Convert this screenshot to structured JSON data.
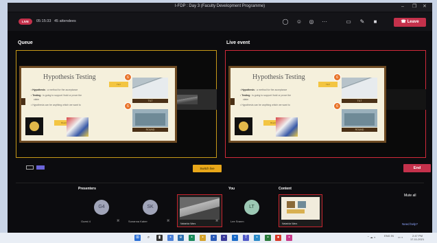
{
  "window": {
    "title": "I-FDP : Day 3 (Faculty Development Programme)"
  },
  "toolbar": {
    "live_badge": "LIVE",
    "timer": "05:15:33",
    "attendees": "45 attendees",
    "leave_label": "Leave"
  },
  "stage": {
    "queue_label": "Queue",
    "live_label": "Live event",
    "switch_label": "Switch live",
    "end_label": "End"
  },
  "slide": {
    "title": "Hypothesis Testing",
    "bullets": [
      {
        "term": "Hypothesis",
        "rest": " : a method for the acceptance"
      },
      {
        "term": "Testing",
        "rest": " : is going to support /hold or prove the"
      },
      {
        "term": "",
        "rest": "claim"
      },
      {
        "term": "",
        "rest": "Hypothesis can be anything which we want to"
      }
    ],
    "callout_top": "TILT",
    "callout_left": "Brazil",
    "tag_top": "TILT",
    "tag_bottom": "ROUND",
    "num_a": "6",
    "num_b": "6"
  },
  "participants": {
    "presenters_label": "Presenters",
    "you_label": "You",
    "content_label": "Content",
    "mute_all": "Mute all",
    "need_help": "Need help?",
    "people": [
      {
        "initials": "G4",
        "name": "Guest 4"
      },
      {
        "initials": "SK",
        "name": "Sunanna Kaber"
      },
      {
        "initials": "",
        "name": "Natarida Wars"
      },
      {
        "initials": "LT",
        "name": "Lee Sranm"
      }
    ],
    "content_caption": "Natarida Wars"
  },
  "taskbar": {
    "tray_lang": "ENG IN",
    "time": "2:47 PM",
    "date": "17-11-2021"
  },
  "colors": {
    "accent_red": "#c4314b",
    "queue_border": "#c89a18",
    "live_border": "#d22a3a",
    "switch_yellow": "#e8a71a",
    "toggle_purple": "#6a64d8"
  }
}
